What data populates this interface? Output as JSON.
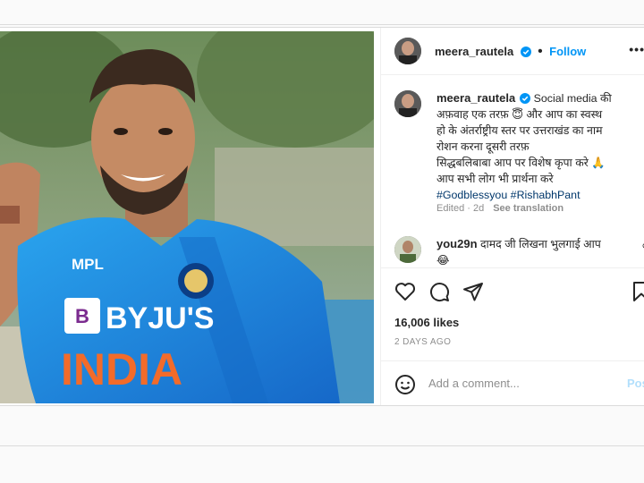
{
  "post": {
    "username": "meera_rautela",
    "follow_label": "Follow",
    "more_label": "•••",
    "caption": {
      "username": "meera_rautela",
      "text_lines": [
        "Social media की",
        "अफ़वाह एक तरफ़ 😇 और आप का स्वस्थ",
        "हो के अंतर्राष्ट्रीय स्तर पर उत्तराखंड का नाम",
        "रोशन करना दूसरी तरफ़",
        "सिद्धबलिबाबा आप पर विशेष कृपा करे 🙏",
        "आप सभी लोग भी प्रार्थना करे"
      ],
      "hashtag_1": "#Godblessyou",
      "hashtag_2": "#RishabhPant"
    },
    "meta": {
      "edited": "Edited · 2d",
      "see_translation": "See translation"
    },
    "comment": {
      "username": "you29n",
      "text": "दामद जी लिखना भुलगाई आप",
      "emoji": "😂"
    },
    "likes": "16,006 likes",
    "time_ago": "2 DAYS AGO",
    "add_comment_placeholder": "Add a comment...",
    "post_label": "Post"
  },
  "photo": {
    "jersey_sponsor": "BYJU'S",
    "jersey_country": "INDIA",
    "jersey_brand": "MPL"
  },
  "icons": [
    "verified-badge-icon",
    "heart-icon",
    "comment-icon",
    "share-icon",
    "bookmark-icon",
    "emoji-icon",
    "more-icon"
  ],
  "colors": {
    "accent": "#0095f6",
    "hashtag": "#00376b",
    "muted": "#8e8e8e",
    "jersey": "#1e8fe0"
  }
}
